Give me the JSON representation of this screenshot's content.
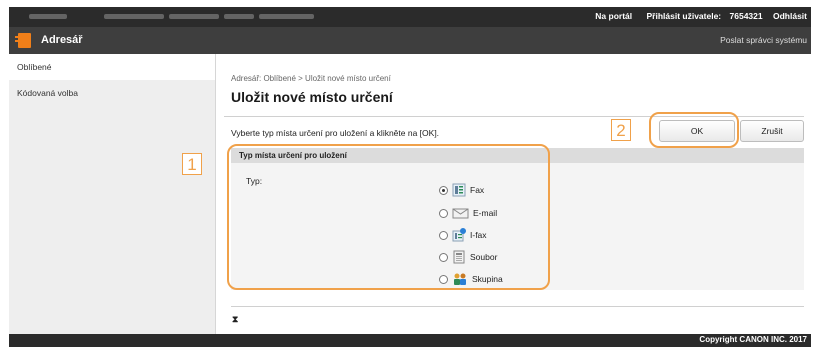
{
  "topbar": {
    "portal_link": "Na portál",
    "login_label": "Přihlásit uživatele:",
    "user_id": "7654321",
    "logout_link": "Odhlásit"
  },
  "appbar": {
    "title": "Adresář",
    "mail_admin": "Poslat správci systému"
  },
  "sidebar": {
    "items": [
      {
        "label": "Oblíbené"
      },
      {
        "label": "Kódovaná volba"
      }
    ]
  },
  "main": {
    "breadcrumb": "Adresář: Oblíbené > Uložit nové místo určení",
    "title": "Uložit nové místo určení",
    "instruction": "Vyberte typ místa určení pro uložení a klikněte na [OK].",
    "ok_label": "OK",
    "cancel_label": "Zrušit",
    "section_title": "Typ místa určení pro uložení",
    "type_label": "Typ:",
    "options": [
      {
        "label": "Fax",
        "icon": "fax-icon",
        "selected": true
      },
      {
        "label": "E-mail",
        "icon": "email-icon",
        "selected": false
      },
      {
        "label": "I-fax",
        "icon": "ifax-icon",
        "selected": false
      },
      {
        "label": "Soubor",
        "icon": "file-server-icon",
        "selected": false
      },
      {
        "label": "Skupina",
        "icon": "group-icon",
        "selected": false
      }
    ],
    "sort_icon": "sort-icon"
  },
  "footer": {
    "copyright": "Copyright CANON INC. 2017"
  },
  "callouts": {
    "one": "1",
    "two": "2"
  },
  "colors": {
    "topbar": "#2b2b2b",
    "appbar": "#3e3e3e",
    "accent": "#f07f19",
    "callout": "#f0a14a"
  }
}
